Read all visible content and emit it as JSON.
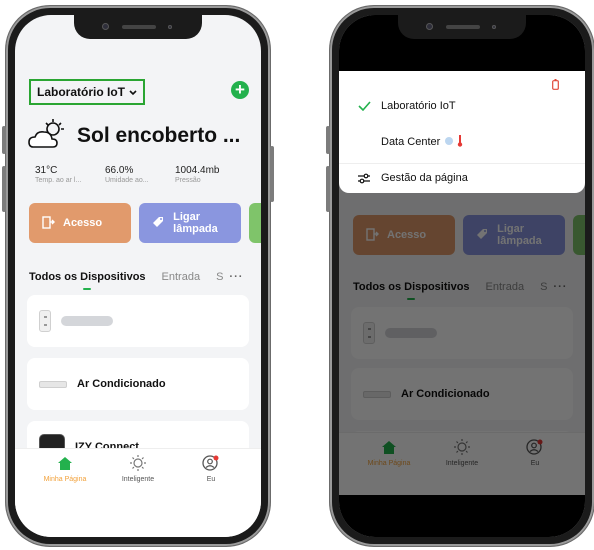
{
  "location": {
    "name": "Laboratório IoT"
  },
  "weather": {
    "condition": "Sol encoberto ...",
    "stats": [
      {
        "value": "31°C",
        "label": "Temp. ao ar l..."
      },
      {
        "value": "66.0%",
        "label": "Umidade ao..."
      },
      {
        "value": "1004.4mb",
        "label": "Pressão"
      }
    ]
  },
  "scenes": [
    {
      "label": "Acesso",
      "color": "#e19a6c"
    },
    {
      "label": "Ligar lâmpada",
      "color": "#8a96df"
    }
  ],
  "tabs": {
    "active": "Todos os Dispositivos",
    "second": "Entrada",
    "third": "S",
    "more": "···"
  },
  "devices": [
    {
      "name": ""
    },
    {
      "name": "Ar Condicionado"
    },
    {
      "name": "IZY Connect"
    }
  ],
  "tabbar": [
    {
      "label": "Minha Página",
      "icon": "home-icon"
    },
    {
      "label": "Inteligente",
      "icon": "sun-icon"
    },
    {
      "label": "Eu",
      "icon": "user-icon"
    }
  ],
  "menu": {
    "items": [
      {
        "label": "Laboratório IoT",
        "icon": "check-icon"
      },
      {
        "label": "Data Center",
        "icon": ""
      },
      {
        "label": "Gestão da página",
        "icon": "sliders-icon"
      }
    ]
  },
  "colors": {
    "accent": "#23b14d",
    "active_tab": "#f2a13a",
    "highlight_box": "#2aa532"
  }
}
